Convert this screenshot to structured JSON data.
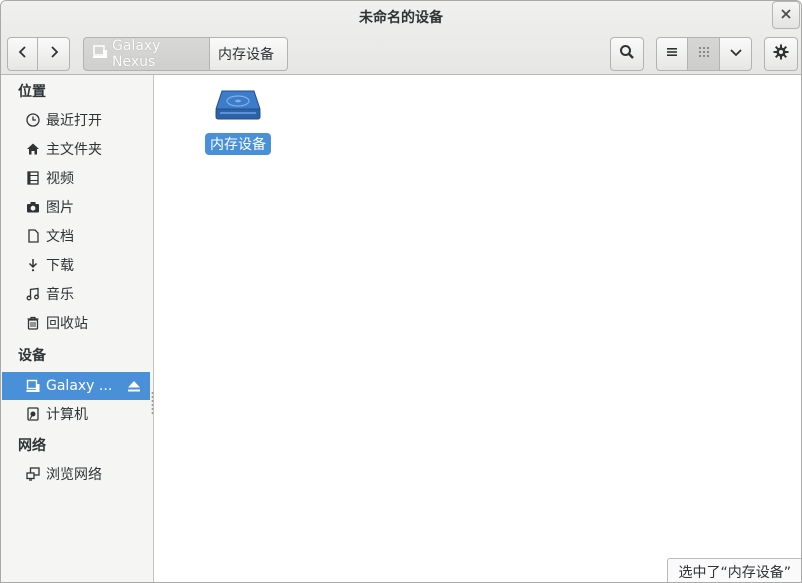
{
  "window": {
    "title": "未命名的设备"
  },
  "pathbar": {
    "device": "Galaxy Nexus",
    "current": "内存设备"
  },
  "icons": {
    "close": "close-icon",
    "back": "chevron-left-icon",
    "forward": "chevron-right-icon",
    "search": "search-icon",
    "list": "list-view-icon",
    "grid": "grid-view-icon",
    "menu": "chevron-down-icon",
    "gear": "gear-icon"
  },
  "sidebar": {
    "places_heading": "位置",
    "places": [
      {
        "label": "最近打开",
        "icon": "clock-icon"
      },
      {
        "label": "主文件夹",
        "icon": "home-icon"
      },
      {
        "label": "视频",
        "icon": "film-icon"
      },
      {
        "label": "图片",
        "icon": "camera-icon"
      },
      {
        "label": "文档",
        "icon": "document-icon"
      },
      {
        "label": "下载",
        "icon": "download-icon"
      },
      {
        "label": "音乐",
        "icon": "music-icon"
      },
      {
        "label": "回收站",
        "icon": "trash-icon"
      }
    ],
    "devices_heading": "设备",
    "devices": [
      {
        "label": "Galaxy ...",
        "icon": "phone-device-icon",
        "selected": true
      },
      {
        "label": "计算机",
        "icon": "computer-icon"
      }
    ],
    "network_heading": "网络",
    "network": [
      {
        "label": "浏览网络",
        "icon": "network-icon"
      }
    ]
  },
  "content": {
    "items": [
      {
        "label": "内存设备",
        "icon": "drive-icon",
        "selected": true
      }
    ]
  },
  "status": {
    "text": "选中了“内存设备”"
  },
  "colors": {
    "accent": "#4a90d9",
    "header": "#e8e8e7",
    "sidebar": "#f5f5f4"
  }
}
